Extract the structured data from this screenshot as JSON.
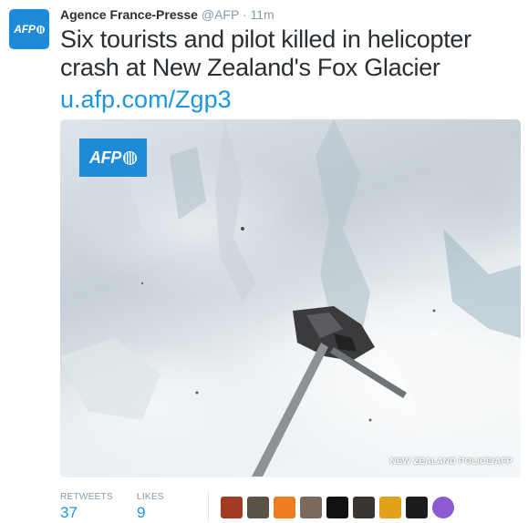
{
  "tweet": {
    "author_name": "Agence France-Presse",
    "author_handle": "@AFP",
    "separator": "·",
    "time": "11m",
    "text": "Six tourists and pilot killed in helicopter crash at New Zealand's Fox Glacier",
    "link": "u.afp.com/Zgp3"
  },
  "avatar": {
    "logo_text": "AFP",
    "icon": "afp-logo-icon",
    "color": "#1f8ad8"
  },
  "media": {
    "logo_text": "AFP",
    "credit": "NEW ZEALAND POLICE/AFP"
  },
  "stats": {
    "retweets_label": "RETWEETS",
    "retweets_value": "37",
    "likes_label": "LIKES",
    "likes_value": "9"
  },
  "likers": [
    {
      "name": "liker-avatar-1",
      "color": "#a23b24"
    },
    {
      "name": "liker-avatar-2",
      "color": "#5b5247"
    },
    {
      "name": "liker-avatar-3",
      "color": "#f07c22"
    },
    {
      "name": "liker-avatar-4",
      "color": "#7a6a5e"
    },
    {
      "name": "liker-avatar-5",
      "color": "#111111"
    },
    {
      "name": "liker-avatar-6",
      "color": "#3a3532"
    },
    {
      "name": "liker-avatar-7",
      "color": "#e0a21a"
    },
    {
      "name": "liker-avatar-8",
      "color": "#1c1c1c"
    },
    {
      "name": "liker-avatar-9",
      "color": "#8c5bd1"
    }
  ],
  "colors": {
    "link": "#1b95e0",
    "muted": "#8899a6",
    "text": "#292f33",
    "brand": "#1f8ad8"
  }
}
